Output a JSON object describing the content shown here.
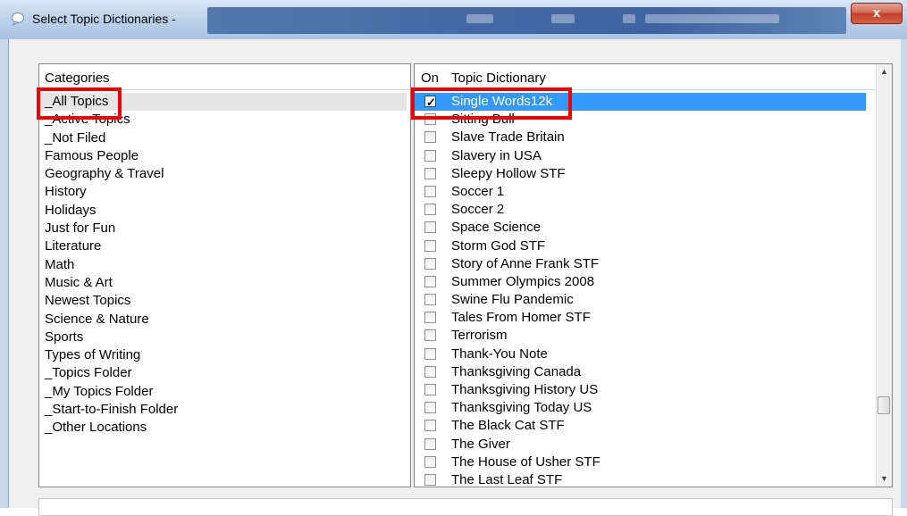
{
  "window": {
    "title": "Select Topic Dictionaries -",
    "close_glyph": "x"
  },
  "categories": {
    "header": "Categories",
    "items": [
      "_All Topics",
      "_Active Topics",
      "_Not Filed",
      "Famous People",
      "Geography & Travel",
      "History",
      "Holidays",
      "Just for Fun",
      "Literature",
      "Math",
      "Music & Art",
      "Newest Topics",
      "Science & Nature",
      "Sports",
      "Types of Writing",
      "_Topics Folder",
      "_My Topics Folder",
      "_Start-to-Finish Folder",
      "_Other Locations"
    ],
    "selected": "_All Topics"
  },
  "topics": {
    "header_on": "On",
    "header_name": "Topic Dictionary",
    "items": [
      {
        "name": "Single Words12k",
        "on": true
      },
      {
        "name": "Sitting Bull",
        "on": false
      },
      {
        "name": "Slave Trade Britain",
        "on": false
      },
      {
        "name": "Slavery in USA",
        "on": false
      },
      {
        "name": "Sleepy Hollow STF",
        "on": false
      },
      {
        "name": "Soccer 1",
        "on": false
      },
      {
        "name": "Soccer 2",
        "on": false
      },
      {
        "name": "Space Science",
        "on": false
      },
      {
        "name": "Storm God STF",
        "on": false
      },
      {
        "name": "Story of Anne Frank STF",
        "on": false
      },
      {
        "name": "Summer Olympics 2008",
        "on": false
      },
      {
        "name": "Swine Flu Pandemic",
        "on": false
      },
      {
        "name": "Tales From Homer STF",
        "on": false
      },
      {
        "name": "Terrorism",
        "on": false
      },
      {
        "name": "Thank-You Note",
        "on": false
      },
      {
        "name": "Thanksgiving Canada",
        "on": false
      },
      {
        "name": "Thanksgiving History US",
        "on": false
      },
      {
        "name": "Thanksgiving Today US",
        "on": false
      },
      {
        "name": "The Black Cat STF",
        "on": false
      },
      {
        "name": "The Giver",
        "on": false
      },
      {
        "name": "The House of Usher STF",
        "on": false
      },
      {
        "name": "The Last Leaf STF",
        "on": false
      }
    ],
    "selected": "Single Words12k",
    "check_glyph": "✓"
  },
  "icons": {
    "app": "speech-bubble-icon",
    "scroll_up": "▲",
    "scroll_down": "▼"
  },
  "colors": {
    "selection": "#3399ff",
    "annotation": "#ee0000"
  }
}
